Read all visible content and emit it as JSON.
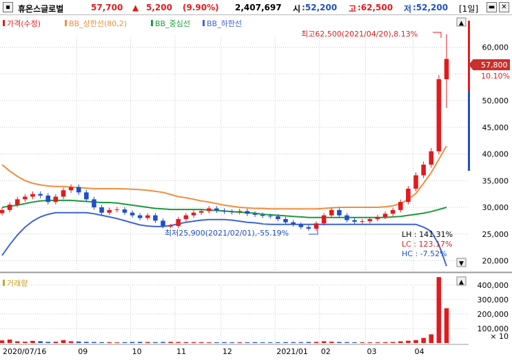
{
  "header": {
    "stock_name": "휴온스글로벌",
    "price": "57,700",
    "change_arrow": "▲",
    "change": "5,200",
    "change_pct": "(9.90%)",
    "volume": "2,407,697",
    "open_label": "시",
    "open": ":52,200",
    "high_label": "고",
    "high": ":62,500",
    "low_label": "저",
    "low": ":52,200",
    "period": "[1일]"
  },
  "legend": [
    {
      "label": "가격(수정)",
      "color": "#e31a1c"
    },
    {
      "label": "BB_상한선(80,2)",
      "color": "#f28d3c"
    },
    {
      "label": "BB_중심선",
      "color": "#1a9a3a"
    },
    {
      "label": "BB_하한선",
      "color": "#3d62d8"
    }
  ],
  "volume_legend": {
    "label": "거래량",
    "color": "#c9a227"
  },
  "annotations": {
    "high": "최고62,500(2021/04/20),8.13%",
    "low": "최저25,900(2021/02/01),-55.19%",
    "lh": "LH : 141.31%",
    "lc": "LC : 123.17%",
    "hc": "HC : -7.52%"
  },
  "current_price_box": {
    "price": "57,800",
    "pct": "10.10%"
  },
  "colors": {
    "up": "#e31a1c",
    "down": "#1f4fc7",
    "upper": "#f28d3c",
    "mid": "#1a9a3a",
    "lower": "#3d62d8",
    "grid": "#c8c8c8",
    "lh": "#000000",
    "lc": "#e31a1c",
    "hc": "#1f4fc7"
  },
  "chart_data": [
    {
      "type": "candlestick",
      "title": "휴온스글로벌",
      "x_range": [
        "2020-07-16",
        "2021-04-22"
      ],
      "x_ticks": [
        "2020/07/16",
        "09",
        "10",
        "11",
        "12",
        "2021/01",
        "02",
        "03",
        "04"
      ],
      "y_ticks": [
        "20,000",
        "25,000",
        "30,000",
        "35,000",
        "40,000",
        "45,000",
        "50,000",
        "55,000",
        "60,000"
      ],
      "ylim": [
        18000,
        66000
      ],
      "grid": true,
      "series": [
        {
          "name": "가격(수정)",
          "values": [
            29500,
            30500,
            31500,
            32000,
            32500,
            32200,
            31000,
            32000,
            33200,
            33800,
            32800,
            31500,
            30000,
            29000,
            29500,
            29600,
            29000,
            28500,
            28000,
            28500,
            27500,
            26500,
            26500,
            27800,
            28500,
            29000,
            29300,
            29800,
            29400,
            29200,
            29100,
            29300,
            28800,
            28600,
            28400,
            28300,
            27800,
            27200,
            26800,
            26300,
            26000,
            27000,
            28500,
            29500,
            28500,
            27600,
            27300,
            27400,
            27800,
            28200,
            28800,
            29500,
            31000,
            33500,
            36000,
            38000,
            40500,
            54000,
            57800
          ]
        },
        {
          "name": "BB_상한선(80,2)",
          "values": [
            38000,
            36800,
            35800,
            35000,
            34500,
            34200,
            34000,
            33900,
            33900,
            33800,
            33700,
            33600,
            33500,
            33500,
            33500,
            33500,
            33450,
            33400,
            33300,
            33200,
            33000,
            32800,
            32400,
            32000,
            31800,
            31500,
            31200,
            31000,
            30700,
            30400,
            30200,
            30000,
            29900,
            29800,
            29800,
            29700,
            29700,
            29700,
            29700,
            29700,
            29700,
            29700,
            29800,
            29900,
            30000,
            30000,
            30000,
            30000,
            30000,
            30000,
            30100,
            30300,
            30700,
            31500,
            32600,
            34500,
            36500,
            39000,
            41500
          ]
        },
        {
          "name": "BB_중심선",
          "values": [
            30000,
            30200,
            30400,
            30700,
            31000,
            31200,
            31300,
            31300,
            31300,
            31300,
            31200,
            31100,
            31000,
            30900,
            30900,
            30800,
            30600,
            30400,
            30200,
            30000,
            29800,
            29700,
            29600,
            29600,
            29600,
            29600,
            29600,
            29500,
            29400,
            29300,
            29200,
            29100,
            29000,
            28900,
            28700,
            28600,
            28500,
            28400,
            28300,
            28200,
            28100,
            28100,
            28100,
            28100,
            28100,
            28100,
            28100,
            28100,
            28100,
            28100,
            28100,
            28200,
            28300,
            28500,
            28700,
            28900,
            29200,
            29600,
            30000
          ]
        },
        {
          "name": "BB_하한선",
          "values": [
            21000,
            23000,
            24800,
            26300,
            27400,
            28200,
            28700,
            29000,
            29000,
            29000,
            29000,
            29000,
            28800,
            28500,
            28200,
            27900,
            27500,
            27100,
            26700,
            26500,
            26400,
            26400,
            26600,
            26900,
            27200,
            27400,
            27600,
            27700,
            27700,
            27700,
            27600,
            27400,
            27200,
            27100,
            26900,
            26800,
            26800,
            26800,
            26800,
            26800,
            26800,
            26800,
            26800,
            26800,
            26800,
            26800,
            26800,
            26800,
            26800,
            26800,
            26800,
            26800,
            26800,
            26800,
            26800,
            26300,
            25500,
            23000,
            19000
          ]
        }
      ]
    },
    {
      "type": "bar",
      "title": "거래량",
      "y_ticks": [
        "100,000",
        "200,000",
        "300,000",
        "400,000"
      ],
      "y_unit": "× 10",
      "ylim": [
        0,
        480000
      ],
      "values": [
        18000,
        24000,
        12000,
        9000,
        15000,
        12000,
        8000,
        9000,
        20000,
        12000,
        10000,
        8000,
        7000,
        6000,
        6000,
        5000,
        6000,
        7000,
        8000,
        7000,
        6000,
        7000,
        8000,
        7000,
        6000,
        6000,
        6000,
        5000,
        5000,
        6000,
        5000,
        5000,
        5000,
        6000,
        5000,
        5000,
        5000,
        6000,
        6000,
        6000,
        7000,
        8000,
        12000,
        9000,
        7000,
        6000,
        5000,
        5000,
        5000,
        5000,
        6000,
        7000,
        12000,
        16000,
        20000,
        35000,
        60000,
        455000,
        240000
      ]
    }
  ]
}
